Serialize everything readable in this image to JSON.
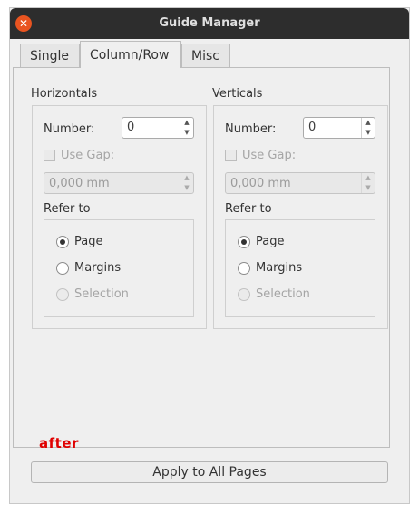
{
  "window": {
    "title": "Guide Manager"
  },
  "tabs": [
    {
      "label": "Single"
    },
    {
      "label": "Column/Row"
    },
    {
      "label": "Misc"
    }
  ],
  "horizontals": {
    "title": "Horizontals",
    "number_label": "Number:",
    "number_value": "0",
    "use_gap_label": "Use Gap:",
    "gap_value": "0,000 mm",
    "refer_to_label": "Refer to",
    "options": [
      "Page",
      "Margins",
      "Selection"
    ]
  },
  "verticals": {
    "title": "Verticals",
    "number_label": "Number:",
    "number_value": "0",
    "use_gap_label": "Use Gap:",
    "gap_value": "0,000 mm",
    "refer_to_label": "Refer to",
    "options": [
      "Page",
      "Margins",
      "Selection"
    ]
  },
  "annotation": "after",
  "apply_button": "Apply to All Pages"
}
